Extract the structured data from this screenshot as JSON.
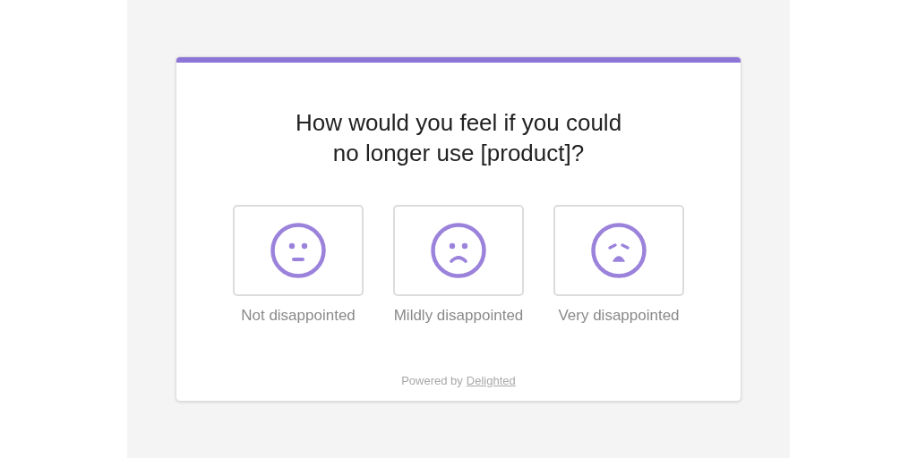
{
  "survey": {
    "question_lines": [
      "How would you feel if you could",
      "no longer use [product]?"
    ],
    "options": [
      {
        "kind": "neutral",
        "label": "Not disappointed"
      },
      {
        "kind": "sad",
        "label": "Mildly disappointed"
      },
      {
        "kind": "distressed",
        "label": "Very disappointed"
      }
    ],
    "footer": {
      "text": "Powered by",
      "link": "Delighted"
    }
  }
}
